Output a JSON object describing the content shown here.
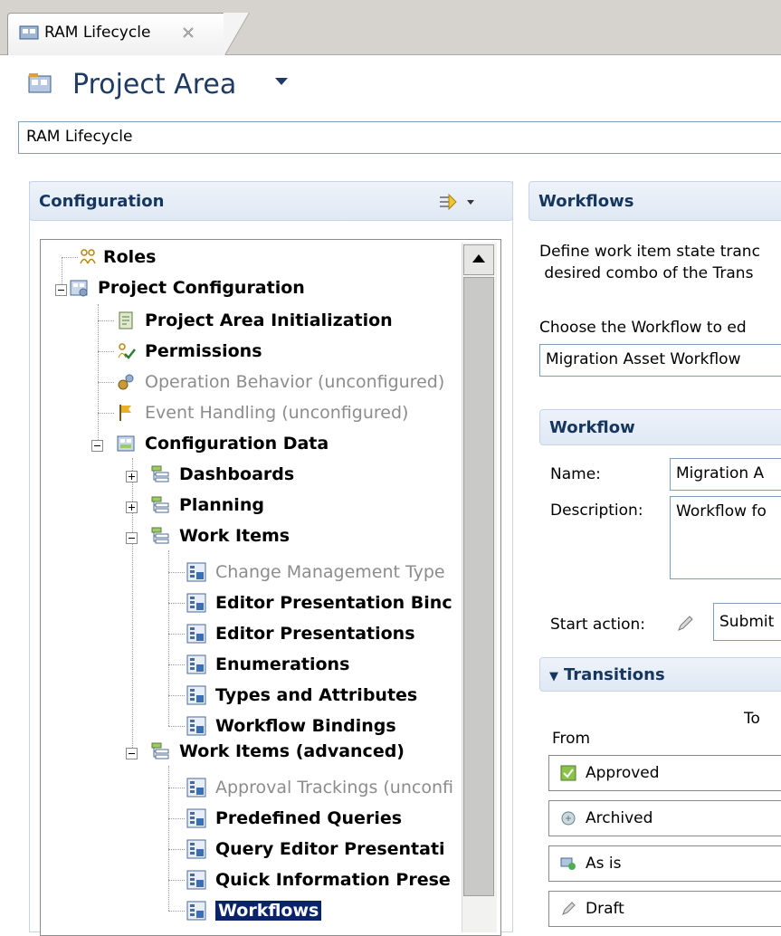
{
  "editor_tab": {
    "label": "RAM Lifecycle",
    "close_icon": "close-x-icon"
  },
  "header": {
    "title": "Project Area",
    "name_value": "RAM Lifecycle"
  },
  "configuration": {
    "title": "Configuration",
    "tree": [
      {
        "label": "Roles",
        "style": "bold"
      },
      {
        "label": "Project Configuration",
        "style": "bold"
      },
      {
        "label": "Project Area Initialization",
        "style": "bold"
      },
      {
        "label": "Permissions",
        "style": "bold"
      },
      {
        "label": "Operation Behavior (unconfigured)",
        "style": "grey"
      },
      {
        "label": "Event Handling (unconfigured)",
        "style": "grey"
      },
      {
        "label": "Configuration Data",
        "style": "bold"
      },
      {
        "label": "Dashboards",
        "style": "bold"
      },
      {
        "label": "Planning",
        "style": "bold"
      },
      {
        "label": "Work Items",
        "style": "bold"
      },
      {
        "label": "Change Management Type",
        "style": "grey"
      },
      {
        "label": "Editor Presentation Binc",
        "style": "bold"
      },
      {
        "label": "Editor Presentations",
        "style": "bold"
      },
      {
        "label": "Enumerations",
        "style": "bold"
      },
      {
        "label": "Types and Attributes",
        "style": "bold"
      },
      {
        "label": "Workflow Bindings",
        "style": "bold"
      },
      {
        "label": "Work Items (advanced)",
        "style": "bold"
      },
      {
        "label": "Approval Trackings (unconfi",
        "style": "grey"
      },
      {
        "label": "Predefined Queries",
        "style": "bold"
      },
      {
        "label": "Query Editor Presentati",
        "style": "bold"
      },
      {
        "label": "Quick Information Prese",
        "style": "bold"
      },
      {
        "label": "Workflows",
        "style": "bold",
        "selected": true
      }
    ]
  },
  "workflows": {
    "title": "Workflows",
    "description_line1": "Define work item state tranc",
    "description_line2": " desired combo of the Trans",
    "choose_label": "Choose the Workflow to ed",
    "selected_workflow": "Migration Asset Workflow",
    "workflow_section": {
      "title": "Workflow",
      "name_label": "Name:",
      "name_value": "Migration A",
      "description_label": "Description:",
      "description_value": "Workflow fo",
      "start_action_label": "Start action:",
      "start_action_value": "Submit"
    },
    "transitions": {
      "title": "Transitions",
      "to_label": "To",
      "from_label": "From",
      "states": [
        "Approved",
        "Archived",
        "As is",
        "Draft"
      ]
    }
  }
}
